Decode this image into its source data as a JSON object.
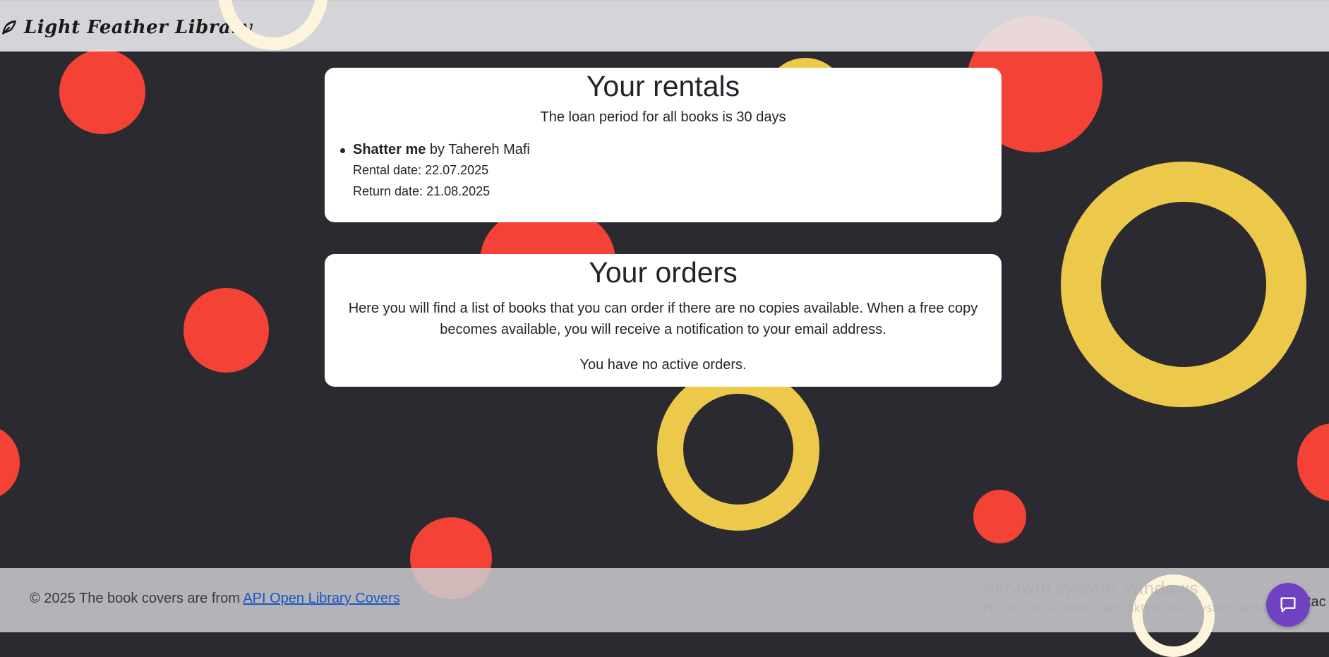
{
  "navbar": {
    "brand": "Light Feather Library"
  },
  "rentals": {
    "heading": "Your rentals",
    "loan_period": "The loan period for all books is 30 days",
    "items": [
      {
        "title": "Shatter me",
        "author_text": " by Tahereh Mafi",
        "rental_date": "Rental date: 22.07.2025",
        "return_date": "Return date: 21.08.2025"
      }
    ]
  },
  "orders": {
    "heading": "Your orders",
    "intro": "Here you will find a list of books that you can order if there are no copies available. When a free copy becomes available, you will receive a notification to your email address.",
    "empty_message": "You have no active orders."
  },
  "footer": {
    "copyright": "© 2025 The book covers are from ",
    "link_text": "API Open Library Covers",
    "contact_tail": "tac"
  },
  "system_watermark": {
    "line1": "Aktywuj system Windows",
    "line2": "Przejdź do ustawień, aby aktywować system Windows."
  },
  "icons": {
    "brand": "feather-icon",
    "chat": "chat-icon"
  },
  "colors": {
    "background": "#2b2a30",
    "accent_red": "#f44336",
    "accent_yellow": "#ecc94b",
    "chat_button": "#6e42c1",
    "link": "#1a56c4"
  }
}
